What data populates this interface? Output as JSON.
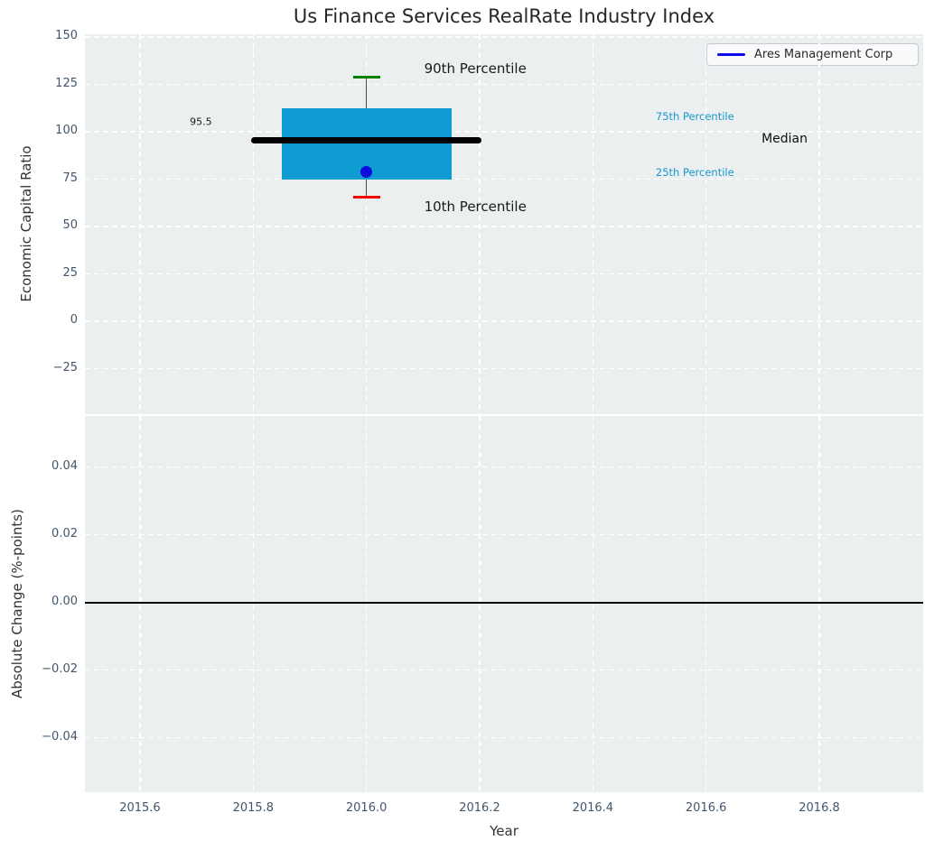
{
  "figure": {
    "title": "Us Finance Services RealRate Industry Index",
    "legend": {
      "label": "Ares Management Corp",
      "line_color": "#0a0af0"
    }
  },
  "colors": {
    "panel_bg": "#EBEFF0",
    "grid": "#FFFFFF",
    "tick_label": "#42566B",
    "axis_label": "#333333",
    "title": "#262626",
    "box_fill": "#0F9CD3",
    "whisker": "#4A4A4A",
    "cap_90th": "#008000",
    "cap_10th": "#F20000",
    "median_line": "#000000",
    "company_marker": "#0D0DDB",
    "percentile_label": "#1699CC",
    "zero_line": "#000000"
  },
  "chart_data": [
    {
      "type": "boxplot",
      "panel": "top",
      "title": "Us Finance Services RealRate Industry Index",
      "ylabel": "Economic Capital Ratio",
      "xlabel": "",
      "grid": true,
      "xlim": [
        2015.5027,
        2016.9835
      ],
      "ylim": [
        -49.0,
        151.43
      ],
      "yticks": [
        {
          "v": 150,
          "label": "150"
        },
        {
          "v": 125,
          "label": "125"
        },
        {
          "v": 100,
          "label": "100"
        },
        {
          "v": 75,
          "label": "75"
        },
        {
          "v": 50,
          "label": "50"
        },
        {
          "v": 25,
          "label": "25"
        },
        {
          "v": 0,
          "label": "0"
        },
        {
          "v": -25,
          "label": "−25"
        }
      ],
      "box": {
        "x": 2016.0,
        "box_left": 2015.85,
        "box_right": 2016.15,
        "median": 95.5,
        "median_line_left": 2015.796,
        "median_line_right": 2016.204,
        "q1": 74.8,
        "q3": 112.3,
        "p10": 65.5,
        "p90": 128.8
      },
      "company_point": {
        "name": "Ares Management Corp",
        "x": 2016.0,
        "y": 78.7
      },
      "annotations": [
        {
          "text": "90th Percentile",
          "x": 2016.102,
          "y": 137.6,
          "size": 15,
          "color": "#1a1a1a",
          "anchor": "top-left"
        },
        {
          "text": "10th Percentile",
          "x": 2016.102,
          "y": 65.0,
          "size": 15,
          "color": "#1a1a1a",
          "anchor": "top-left"
        },
        {
          "text": "95.5",
          "x": 2015.688,
          "y": 105.3,
          "size": 11,
          "color": "#1a1a1a",
          "anchor": "middle-left"
        },
        {
          "text": "75th Percentile",
          "x": 2016.511,
          "y": 108.3,
          "size": 11.5,
          "color": "#1699CC",
          "anchor": "middle-left"
        },
        {
          "text": "25th Percentile",
          "x": 2016.511,
          "y": 78.4,
          "size": 11.5,
          "color": "#1699CC",
          "anchor": "middle-left"
        },
        {
          "text": "Median",
          "x": 2016.698,
          "y": 96.0,
          "size": 14,
          "color": "#111111",
          "anchor": "middle-left"
        }
      ],
      "legend": [
        "Ares Management Corp"
      ],
      "legend_position": "upper right"
    },
    {
      "type": "line",
      "panel": "bottom",
      "ylabel": "Absolute Change (%-points)",
      "xlabel": "Year",
      "grid": true,
      "xlim": [
        2015.5027,
        2016.9835
      ],
      "ylim": [
        -0.0561,
        0.0551
      ],
      "yticks": [
        {
          "v": 0.04,
          "label": "0.04"
        },
        {
          "v": 0.02,
          "label": "0.02"
        },
        {
          "v": 0.0,
          "label": "0.00"
        },
        {
          "v": -0.02,
          "label": "−0.02"
        },
        {
          "v": -0.04,
          "label": "−0.04"
        }
      ],
      "xticks": [
        {
          "v": 2015.6,
          "label": "2015.6"
        },
        {
          "v": 2015.8,
          "label": "2015.8"
        },
        {
          "v": 2016.0,
          "label": "2016.0"
        },
        {
          "v": 2016.2,
          "label": "2016.2"
        },
        {
          "v": 2016.4,
          "label": "2016.4"
        },
        {
          "v": 2016.6,
          "label": "2016.6"
        },
        {
          "v": 2016.8,
          "label": "2016.8"
        }
      ],
      "axhline": 0.0,
      "series": []
    }
  ]
}
